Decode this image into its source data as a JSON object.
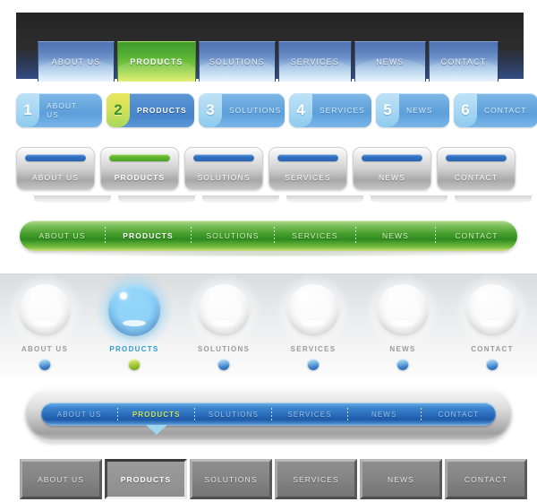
{
  "colors": {
    "accent_blue": "#2a6cbc",
    "accent_green": "#5fb52f",
    "active_green_text": "#c9e65e",
    "active_blue_text": "#2f9cd4",
    "dark_bar": "#2c2c2c",
    "silver": "#cfcfcf",
    "gray_tab": "#858585"
  },
  "labels": {
    "about": "ABOUT US",
    "products": "PRODUCTS",
    "solutions": "SOLUTIONS",
    "services": "SERVICES",
    "news": "NEWS",
    "contact": "CONTACT"
  },
  "nav1": {
    "style_name": "dark-bar-blue-tabs",
    "active_index": 1,
    "items": [
      {
        "label": "ABOUT US",
        "active": false
      },
      {
        "label": "PRODUCTS",
        "active": true
      },
      {
        "label": "SOLUTIONS",
        "active": false
      },
      {
        "label": "SERVICES",
        "active": false
      },
      {
        "label": "NEWS",
        "active": false
      },
      {
        "label": "CONTACT",
        "active": false
      }
    ]
  },
  "nav2": {
    "style_name": "numbered-rounded-tabs",
    "active_index": 1,
    "items": [
      {
        "number": "1",
        "label": "ABOUT US",
        "active": false
      },
      {
        "number": "2",
        "label": "PRODUCTS",
        "active": true
      },
      {
        "number": "3",
        "label": "SOLUTIONS",
        "active": false
      },
      {
        "number": "4",
        "label": "SERVICES",
        "active": false
      },
      {
        "number": "5",
        "label": "NEWS",
        "active": false
      },
      {
        "number": "6",
        "label": "CONTACT",
        "active": false
      }
    ]
  },
  "nav3": {
    "style_name": "silver-buttons-pill-indicator",
    "active_index": 1,
    "items": [
      {
        "label": "ABOUT US",
        "active": false,
        "pill_color": "#2f6fc0"
      },
      {
        "label": "PRODUCTS",
        "active": true,
        "pill_color": "#5fb52f"
      },
      {
        "label": "SOLUTIONS",
        "active": false,
        "pill_color": "#2f6fc0"
      },
      {
        "label": "SERVICES",
        "active": false,
        "pill_color": "#2f6fc0"
      },
      {
        "label": "NEWS",
        "active": false,
        "pill_color": "#2f6fc0"
      },
      {
        "label": "CONTACT",
        "active": false,
        "pill_color": "#2f6fc0"
      }
    ]
  },
  "nav4": {
    "style_name": "green-pill-bar",
    "active_index": 1,
    "items": [
      {
        "label": "ABOUT US",
        "active": false
      },
      {
        "label": "PRODUCTS",
        "active": true
      },
      {
        "label": "SOLUTIONS",
        "active": false
      },
      {
        "label": "SERVICES",
        "active": false
      },
      {
        "label": "NEWS",
        "active": false
      },
      {
        "label": "CONTACT",
        "active": false
      }
    ]
  },
  "nav5": {
    "style_name": "glossy-orbs",
    "active_index": 1,
    "items": [
      {
        "label": "ABOUT US",
        "active": false,
        "orb_color": "#d8d8d8",
        "dot_color": "#3f82c9"
      },
      {
        "label": "PRODUCTS",
        "active": true,
        "orb_color": "#47a6e4",
        "dot_color": "#8cb82b"
      },
      {
        "label": "SOLUTIONS",
        "active": false,
        "orb_color": "#d8d8d8",
        "dot_color": "#3f82c9"
      },
      {
        "label": "SERVICES",
        "active": false,
        "orb_color": "#d8d8d8",
        "dot_color": "#3f82c9"
      },
      {
        "label": "NEWS",
        "active": false,
        "orb_color": "#d8d8d8",
        "dot_color": "#3f82c9"
      },
      {
        "label": "CONTACT",
        "active": false,
        "orb_color": "#d8d8d8",
        "dot_color": "#3f82c9"
      }
    ]
  },
  "nav6": {
    "style_name": "silver-casing-blue-pill",
    "active_index": 1,
    "items": [
      {
        "label": "ABOUT US",
        "active": false
      },
      {
        "label": "PRODUCTS",
        "active": true
      },
      {
        "label": "SOLUTIONS",
        "active": false
      },
      {
        "label": "SERVICES",
        "active": false
      },
      {
        "label": "NEWS",
        "active": false
      },
      {
        "label": "CONTACT",
        "active": false
      }
    ]
  },
  "nav7": {
    "style_name": "gray-beveled-tabs",
    "active_index": 1,
    "items": [
      {
        "label": "ABOUT US",
        "active": false
      },
      {
        "label": "PRODUCTS",
        "active": true
      },
      {
        "label": "SOLUTIONS",
        "active": false
      },
      {
        "label": "SERVICES",
        "active": false
      },
      {
        "label": "NEWS",
        "active": false
      },
      {
        "label": "CONTACT",
        "active": false
      }
    ]
  }
}
